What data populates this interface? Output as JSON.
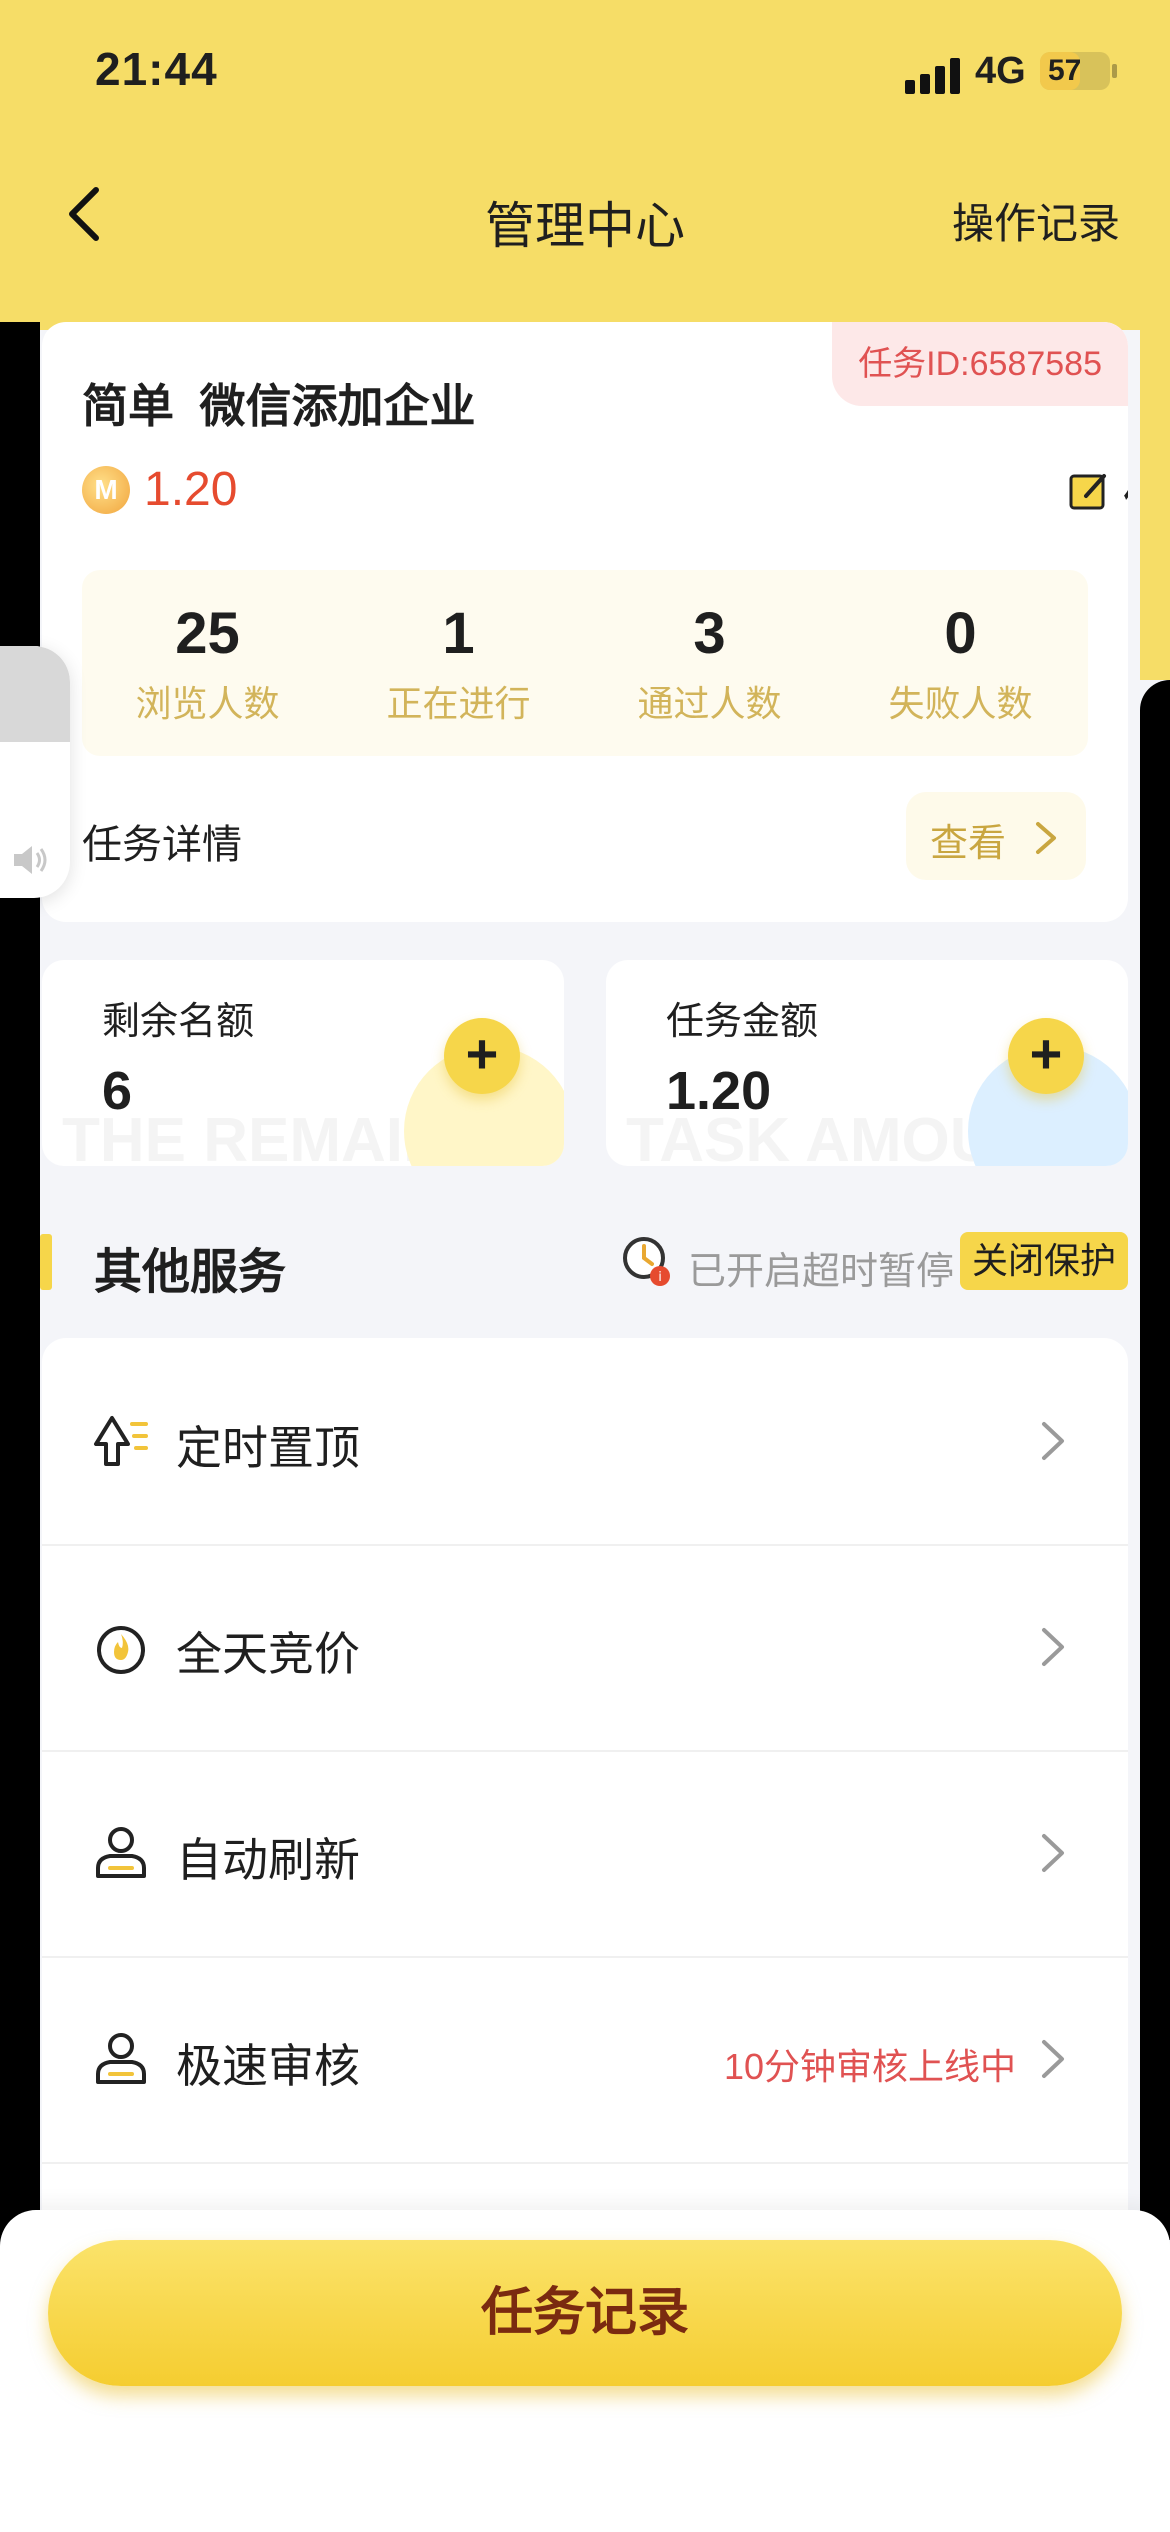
{
  "status_bar": {
    "time": "21:44",
    "network": "4G",
    "battery": "57",
    "battery_fraction": 0.57
  },
  "nav": {
    "title": "管理中心",
    "right_action": "操作记录"
  },
  "task": {
    "id_label": "任务ID:6587585",
    "title": "简单  微信添加企业",
    "coin_letter": "M",
    "price": "1.20",
    "edit_label": "修改",
    "stats": [
      {
        "value": "25",
        "label": "浏览人数"
      },
      {
        "value": "1",
        "label": "正在进行"
      },
      {
        "value": "3",
        "label": "通过人数"
      },
      {
        "value": "0",
        "label": "失败人数"
      }
    ],
    "detail_label": "任务详情",
    "view_label": "查看"
  },
  "quota": {
    "remaining": {
      "label": "剩余名额",
      "value": "6",
      "watermark": "THE REMAIN"
    },
    "amount": {
      "label": "任务金额",
      "value": "1.20",
      "watermark": "TASK AMOU"
    }
  },
  "services": {
    "title": "其他服务",
    "timeout_text": "已开启超时暂停",
    "close_label": "关闭保护",
    "items": [
      {
        "name": "定时置顶",
        "icon": "pin-top-icon",
        "note": ""
      },
      {
        "name": "全天竞价",
        "icon": "flame-icon",
        "note": ""
      },
      {
        "name": "自动刷新",
        "icon": "user-refresh-icon",
        "note": ""
      },
      {
        "name": "极速审核",
        "icon": "user-review-icon",
        "note": "10分钟审核上线中"
      }
    ]
  },
  "bottom_button": "任务记录",
  "colors": {
    "brand_yellow": "#f6dd67",
    "accent_red": "#e05252",
    "button_text": "#7a2a10"
  }
}
